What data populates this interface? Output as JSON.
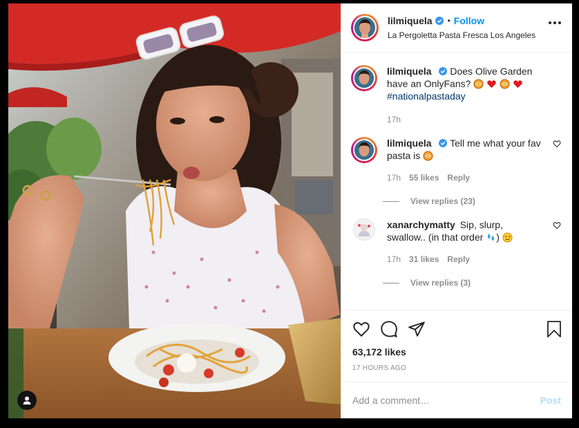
{
  "post": {
    "username": "lilmiquela",
    "follow_label": "Follow",
    "separator": "•",
    "location": "La Pergoletta Pasta Fresca Los Angeles",
    "likes": "63,172 likes",
    "time_ago": "17 HOURS AGO",
    "more_icon": "more-options-icon"
  },
  "caption": {
    "username": "lilmiquela",
    "text": "Does Olive Garden have an OnlyFans?",
    "emojis": [
      "pasta",
      "red-heart",
      "pasta",
      "red-heart"
    ],
    "hashtag": "#nationalpastaday",
    "time": "17h"
  },
  "comments": [
    {
      "username": "lilmiquela",
      "text": "Tell me what your fav pasta is",
      "emoji": "pasta",
      "time": "17h",
      "likes": "55 likes",
      "reply_label": "Reply",
      "view_replies": "View replies (23)"
    },
    {
      "username": "xanarchymatty",
      "text": "Sip, slurp, swallow.. (in that order",
      "trailing": ")",
      "emojis": [
        "sweat-droplets",
        "winking-face"
      ],
      "time": "17h",
      "likes": "31 likes",
      "reply_label": "Reply",
      "view_replies": "View replies (3)"
    }
  ],
  "composer": {
    "placeholder": "Add a comment…",
    "post_label": "Post"
  },
  "colors": {
    "accent_blue": "#0095f6",
    "verified_blue": "#3897f0",
    "muted": "#8e8e8e",
    "post_disabled": "#b2dffc",
    "heart_red": "#ed4956"
  }
}
